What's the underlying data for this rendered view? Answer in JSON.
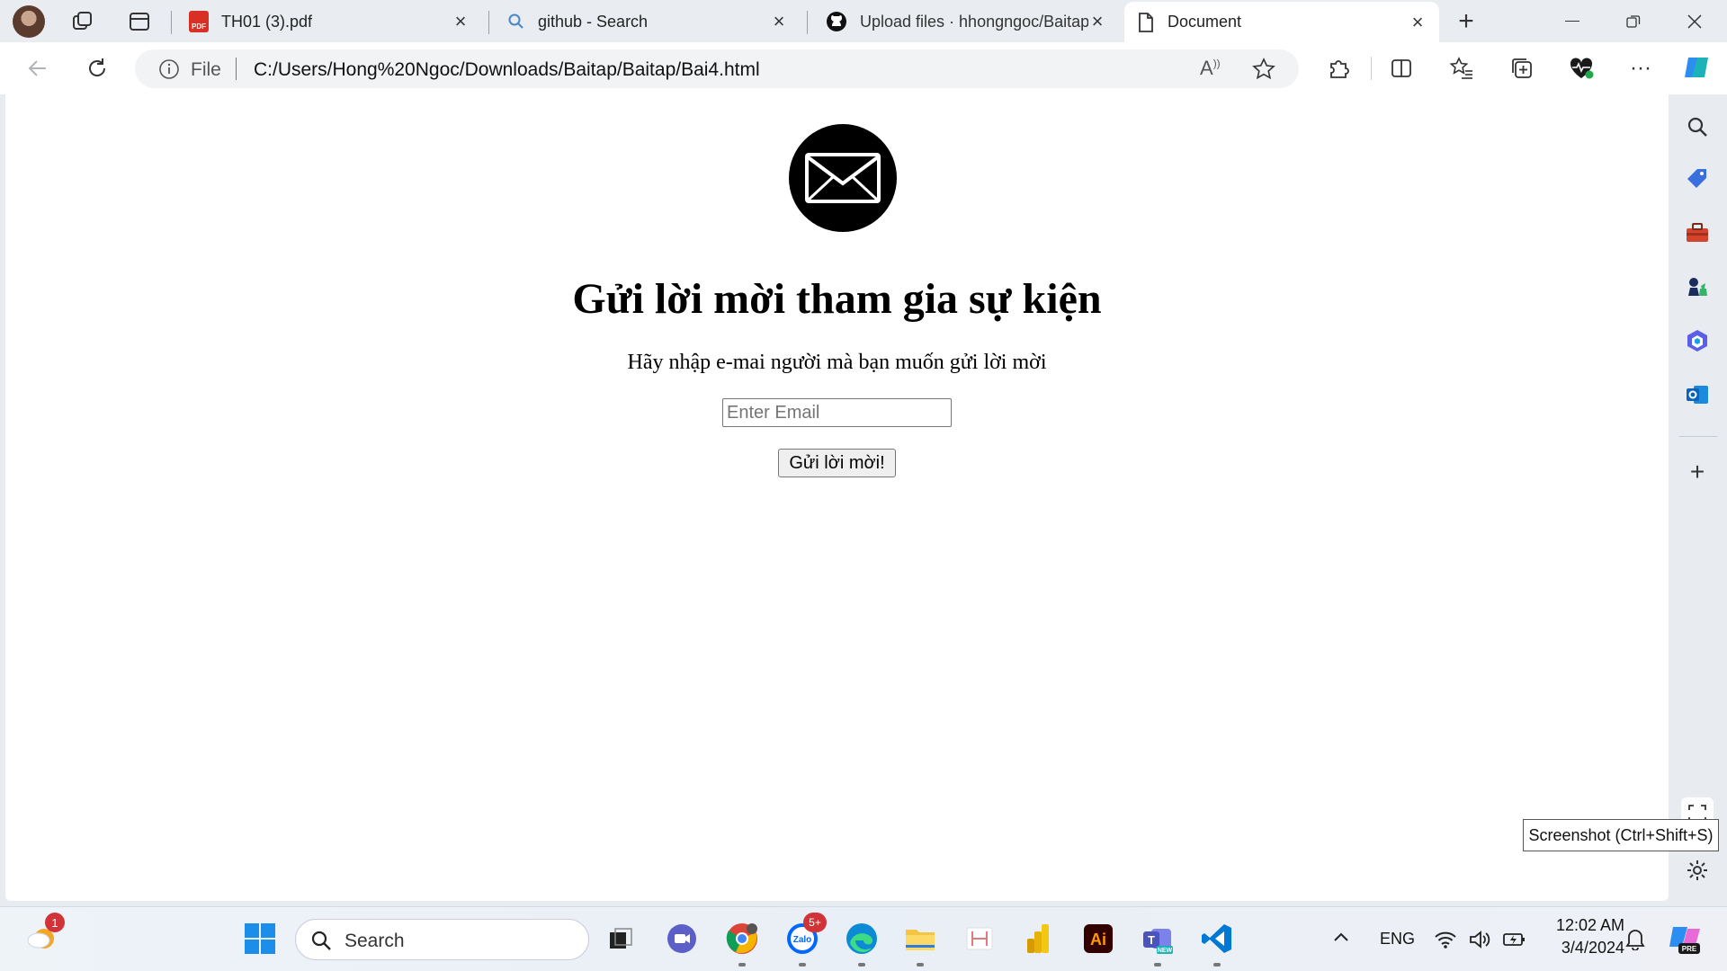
{
  "browser": {
    "tabs": [
      {
        "title": "TH01 (3).pdf",
        "icon": "pdf-icon"
      },
      {
        "title": "github - Search",
        "icon": "search-icon"
      },
      {
        "title": "Upload files · hhongngoc/Baitap",
        "icon": "github-icon"
      },
      {
        "title": "Document",
        "icon": "document-icon",
        "active": true
      }
    ],
    "address": {
      "scheme_label": "File",
      "url": "C:/Users/Hong%20Ngoc/Downloads/Baitap/Baitap/Bai4.html"
    }
  },
  "page": {
    "heading": "Gửi lời mời tham gia sự kiện",
    "subtitle": "Hãy nhập e-mai người mà bạn muốn gửi lời mời",
    "email_placeholder": "Enter Email",
    "email_value": "",
    "button_label": "Gửi lời mời!"
  },
  "sidebar": {
    "tooltip": "Screenshot (Ctrl+Shift+S)"
  },
  "taskbar": {
    "search_label": "Search",
    "language": "ENG",
    "time": "12:02 AM",
    "date": "3/4/2024",
    "notification_badge": "1",
    "zalo_badge": "5+"
  },
  "colors": {
    "accent": "#0067c0",
    "page_bg": "#ffffff",
    "chrome_bg": "#e9ecf0"
  }
}
